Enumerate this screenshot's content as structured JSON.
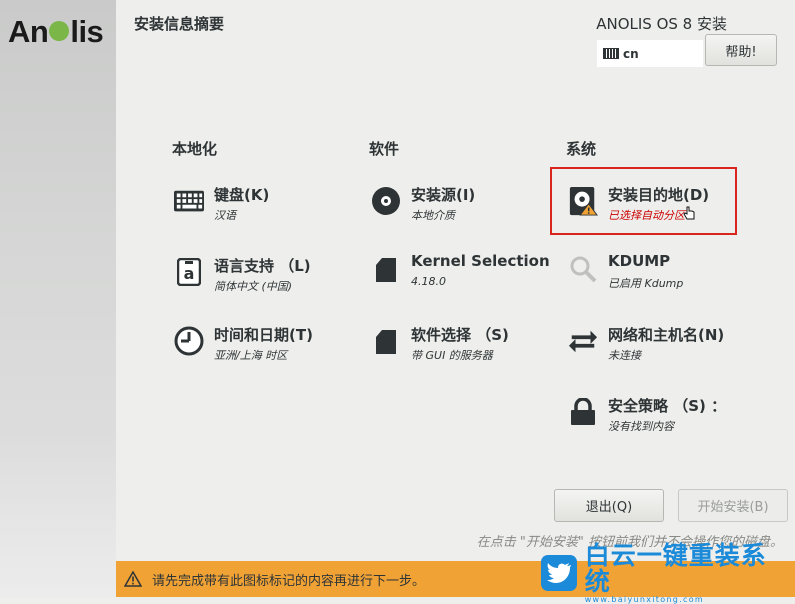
{
  "brand": {
    "logo_text_pre": "An",
    "logo_text_post": "lis"
  },
  "header": {
    "title": "安装信息摘要",
    "os_title": "ANOLIS OS 8 安装",
    "keyboard_layout": "cn",
    "help_label": "帮助!"
  },
  "sections": {
    "localization": {
      "title": "本地化",
      "items": [
        {
          "icon": "keyboard-icon",
          "label": "键盘(K)",
          "status": "汉语"
        },
        {
          "icon": "language-icon",
          "label": "语言支持 （L)",
          "status": "简体中文 (中国)"
        },
        {
          "icon": "clock-icon",
          "label": "时间和日期(T)",
          "status": "亚洲/上海 时区"
        }
      ]
    },
    "software": {
      "title": "软件",
      "items": [
        {
          "icon": "disc-icon",
          "label": "安装源(I)",
          "status": "本地介质"
        },
        {
          "icon": "package-icon",
          "label": "Kernel Selection",
          "status": "4.18.0"
        },
        {
          "icon": "package-icon",
          "label": "软件选择 （S)",
          "status": "带 GUI 的服务器"
        }
      ]
    },
    "system": {
      "title": "系统",
      "items": [
        {
          "icon": "hard-drive-warning-icon",
          "label": "安装目的地(D)",
          "status": "已选择自动分区"
        },
        {
          "icon": "magnifier-icon",
          "label": "KDUMP",
          "status": "已启用 Kdump"
        },
        {
          "icon": "network-arrows-icon",
          "label": "网络和主机名(N)",
          "status": "未连接"
        },
        {
          "icon": "lock-icon",
          "label": "安全策略 （S) ：",
          "status": "没有找到内容"
        }
      ]
    }
  },
  "footer": {
    "quit_label": "退出(Q)",
    "begin_label": "开始安装(B)",
    "note": "在点击 \"开始安装\" 按钮前我们并不会操作您的磁盘。",
    "warning": "请先完成带有此图标标记的内容再进行下一步。"
  },
  "watermark": {
    "title": "白云一键重装系统",
    "url": "www.baiyunxitong.com"
  },
  "colors": {
    "warning_bar": "#f0a235",
    "status_error": "#cc0000",
    "selection_frame": "#d9261c",
    "watermark": "#1b8ad8"
  }
}
